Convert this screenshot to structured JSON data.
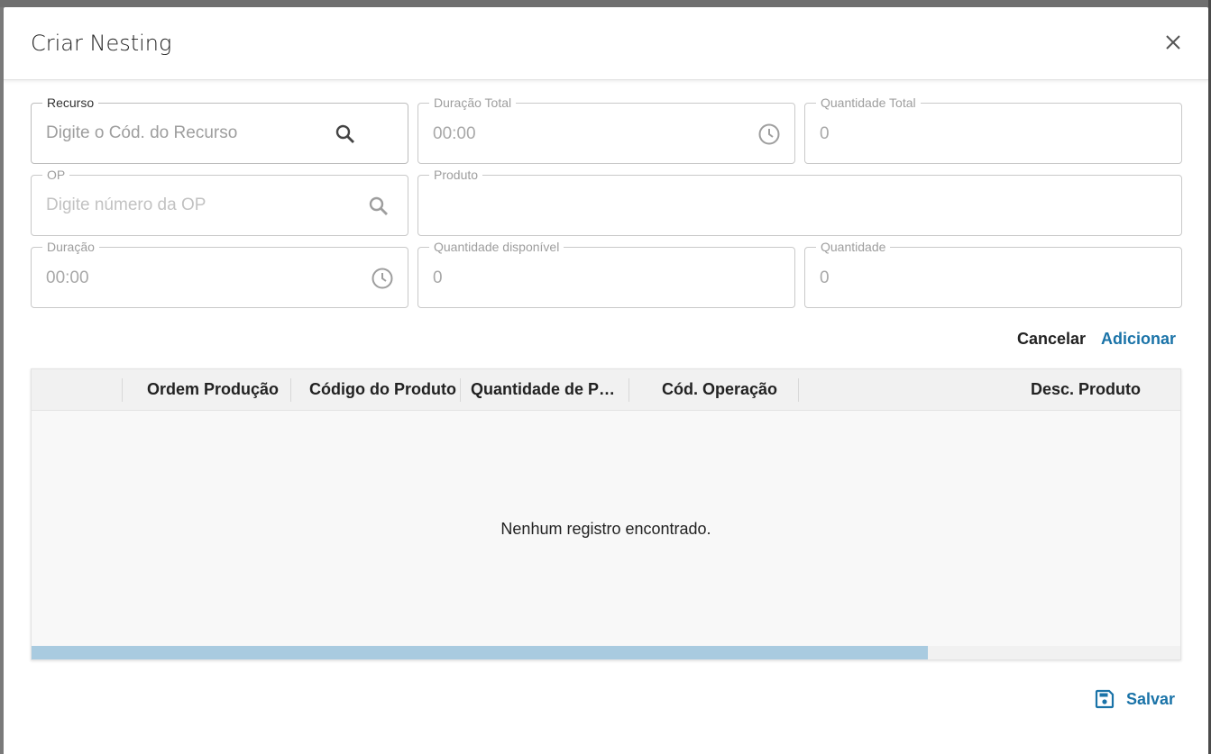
{
  "dialog": {
    "title": "Criar Nesting"
  },
  "fields": {
    "recurso": {
      "label": "Recurso",
      "placeholder": "Digite o Cód. do Recurso"
    },
    "duracao_total": {
      "label": "Duração Total",
      "value": "00:00"
    },
    "quantidade_total": {
      "label": "Quantidade Total",
      "value": "0"
    },
    "op": {
      "label": "OP",
      "placeholder": "Digite número da OP"
    },
    "produto": {
      "label": "Produto",
      "value": ""
    },
    "duracao": {
      "label": "Duração",
      "value": "00:00"
    },
    "quantidade_disponivel": {
      "label": "Quantidade disponível",
      "value": "0"
    },
    "quantidade": {
      "label": "Quantidade",
      "value": "0"
    }
  },
  "actions": {
    "cancel_label": "Cancelar",
    "add_label": "Adicionar",
    "save_label": "Salvar"
  },
  "grid": {
    "columns": [
      "Ordem Produção",
      "Código do Produto",
      "Quantidade de Peças",
      "Cód. Operação",
      "Desc. Produto"
    ],
    "empty_message": "Nenhum registro encontrado.",
    "horizontal_scroll_fraction": 0.78
  },
  "colors": {
    "accent": "#1a73a8",
    "scroll_thumb": "#a9cbe0"
  },
  "icons": {
    "close": "close-icon",
    "search": "search-icon",
    "clock": "clock-icon",
    "save": "save-icon"
  }
}
